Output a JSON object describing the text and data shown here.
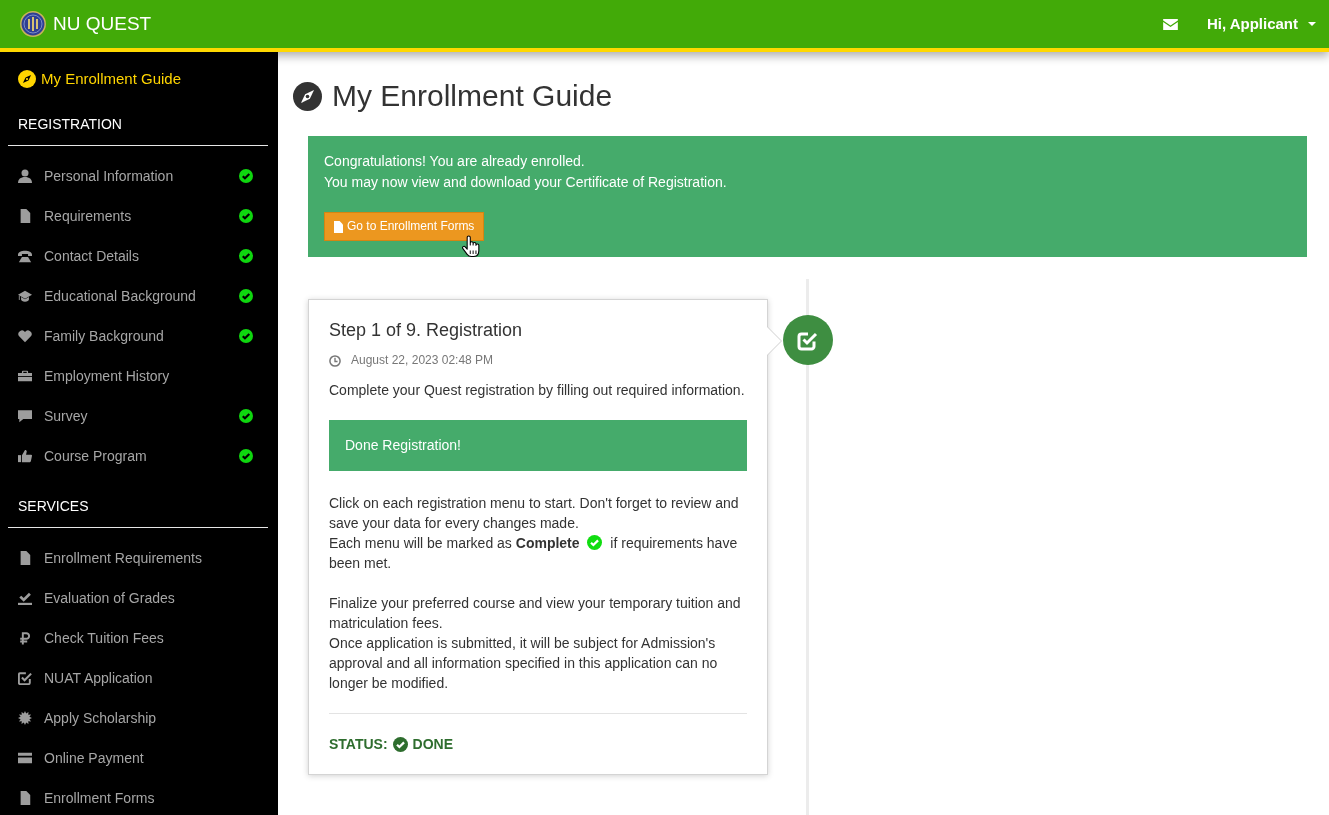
{
  "navbar": {
    "brand": "NU QUEST",
    "user_menu": "Hi, Applicant"
  },
  "sidebar": {
    "guide_link": {
      "label": "My Enrollment Guide",
      "selected": true
    },
    "sections": [
      {
        "title": "REGISTRATION",
        "items": [
          {
            "label": "Personal Information",
            "selected": false,
            "complete": true
          },
          {
            "label": "Requirements",
            "selected": false,
            "complete": true
          },
          {
            "label": "Contact Details",
            "selected": false,
            "complete": true
          },
          {
            "label": "Educational Background",
            "selected": false,
            "complete": true
          },
          {
            "label": "Family Background",
            "selected": false,
            "complete": true
          },
          {
            "label": "Employment History",
            "selected": false,
            "complete": false
          },
          {
            "label": "Survey",
            "selected": false,
            "complete": true
          },
          {
            "label": "Course Program",
            "selected": false,
            "complete": true
          }
        ]
      },
      {
        "title": "SERVICES",
        "items": [
          {
            "label": "Enrollment Requirements",
            "selected": false
          },
          {
            "label": "Evaluation of Grades",
            "selected": false
          },
          {
            "label": "Check Tuition Fees",
            "selected": false
          },
          {
            "label": "NUAT Application",
            "selected": false
          },
          {
            "label": "Apply Scholarship",
            "selected": false
          },
          {
            "label": "Online Payment",
            "selected": false
          },
          {
            "label": "Enrollment Forms",
            "selected": false
          }
        ]
      }
    ]
  },
  "page": {
    "title": "My Enrollment Guide"
  },
  "alert": {
    "lines": [
      "Congratulations! You are already enrolled.",
      "You may now view and download your Certificate of Registration."
    ],
    "button": {
      "label": "Go to Enrollment Forms",
      "hovered": true
    }
  },
  "timeline": [
    {
      "title": "Step 1 of 9. Registration",
      "date": "August 22, 2023 02:48 PM",
      "description": "Complete your Quest registration by filling out required information.",
      "banner": "Done Registration!",
      "paragraphs": [
        [
          {
            "text": "Click on each registration menu to start. Don't forget to review and save your data for every changes made."
          },
          {
            "text": "Each menu will be marked as **Complete**",
            "after_icon": "if requirements have been met."
          }
        ],
        [
          {
            "text": "Finalize your preferred course and view your temporary tuition and matriculation fees."
          },
          {
            "text": "Once application is submitted, it will be subject for Admission's approval and all information specified in this application can no longer be modified."
          }
        ]
      ],
      "status_label": "STATUS:",
      "status": "DONE",
      "completed": true
    }
  ]
}
